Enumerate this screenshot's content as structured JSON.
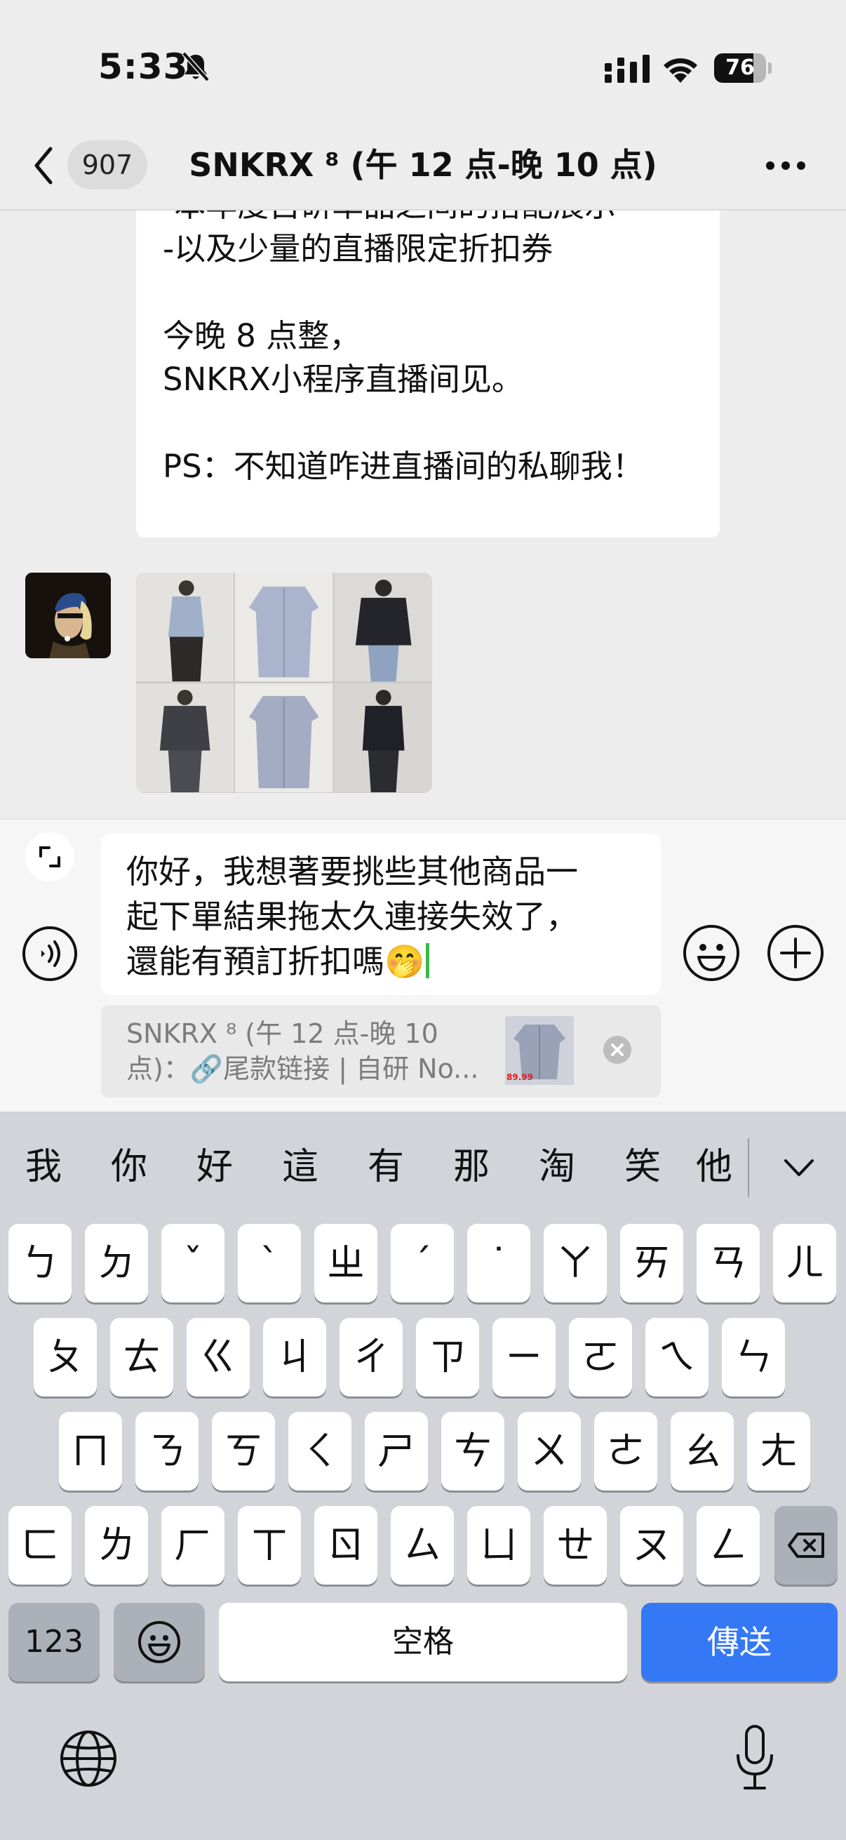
{
  "status_bar": {
    "time": "5:33",
    "battery": "76",
    "battery_level": 0.76
  },
  "nav": {
    "back_count": "907",
    "title": "SNKRX ⁸ (午 12 点-晚 10 点)"
  },
  "message": {
    "lines": [
      "-本年度自研单品之间的搭配展示",
      "-以及少量的直播限定折扣券",
      "",
      "今晚 8 点整，",
      "SNKRX小程序直播间见。",
      "",
      "PS：不知道咋进直播间的私聊我！"
    ]
  },
  "composer": {
    "input_lines": [
      "你好，我想著要挑些其他商品一",
      "起下單結果拖太久連接失效了，",
      "還能有預訂折扣嗎🤭"
    ],
    "quote_lines": [
      "SNKRX ⁸ (午 12 点-晚 10",
      "点)：🔗尾款链接 | 自研 No..."
    ],
    "quote_price": "89.99"
  },
  "keyboard": {
    "candidates": [
      "我",
      "你",
      "好",
      "這",
      "有",
      "那",
      "淘",
      "笑",
      "他"
    ],
    "rows": [
      [
        "ㄅ",
        "ㄉ",
        "ˇ",
        "ˋ",
        "ㄓ",
        "ˊ",
        "˙",
        "ㄚ",
        "ㄞ",
        "ㄢ",
        "ㄦ"
      ],
      [
        "ㄆ",
        "ㄊ",
        "ㄍ",
        "ㄐ",
        "ㄔ",
        "ㄗ",
        "ㄧ",
        "ㄛ",
        "ㄟ",
        "ㄣ"
      ],
      [
        "ㄇ",
        "ㄋ",
        "ㄎ",
        "ㄑ",
        "ㄕ",
        "ㄘ",
        "ㄨ",
        "ㄜ",
        "ㄠ",
        "ㄤ"
      ],
      [
        "ㄈ",
        "ㄌ",
        "ㄏ",
        "ㄒ",
        "ㄖ",
        "ㄙ",
        "ㄩ",
        "ㄝ",
        "ㄡ",
        "ㄥ"
      ]
    ],
    "numbers_label": "123",
    "space_label": "空格",
    "send_label": "傳送"
  },
  "icons": {
    "bell": "bell-slash-icon",
    "signal": "signal-icon",
    "wifi": "wifi-icon",
    "back": "chevron-left-icon",
    "more": "more-icon",
    "expand": "expand-icon",
    "voice": "voice-icon",
    "emoji": "emoji-icon",
    "plus": "plus-icon",
    "close": "close-icon",
    "globe": "globe-icon",
    "mic": "mic-icon",
    "collapse": "chevron-down-icon",
    "delete": "delete-icon"
  },
  "colors": {
    "send": "#3478f6",
    "cursor": "#3cb94a"
  }
}
